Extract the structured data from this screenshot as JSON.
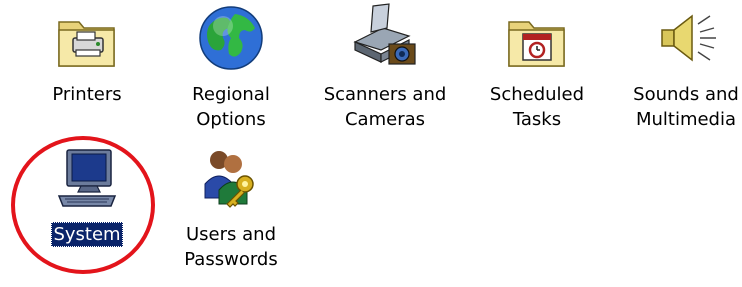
{
  "items": [
    {
      "label": "Printers",
      "icon": "printers-folder-icon"
    },
    {
      "label": "Regional\nOptions",
      "icon": "globe-icon"
    },
    {
      "label": "Scanners and\nCameras",
      "icon": "scanner-camera-icon"
    },
    {
      "label": "Scheduled\nTasks",
      "icon": "scheduled-tasks-folder-icon"
    },
    {
      "label": "Sounds and\nMultimedia",
      "icon": "speaker-icon"
    },
    {
      "label": "System",
      "icon": "computer-icon",
      "selected": true
    },
    {
      "label": "Users and\nPasswords",
      "icon": "users-key-icon"
    }
  ],
  "annotation": {
    "color": "#e3141b",
    "target": "System"
  },
  "colors": {
    "selection_bg": "#0a246a",
    "selection_text": "#ffffff"
  }
}
